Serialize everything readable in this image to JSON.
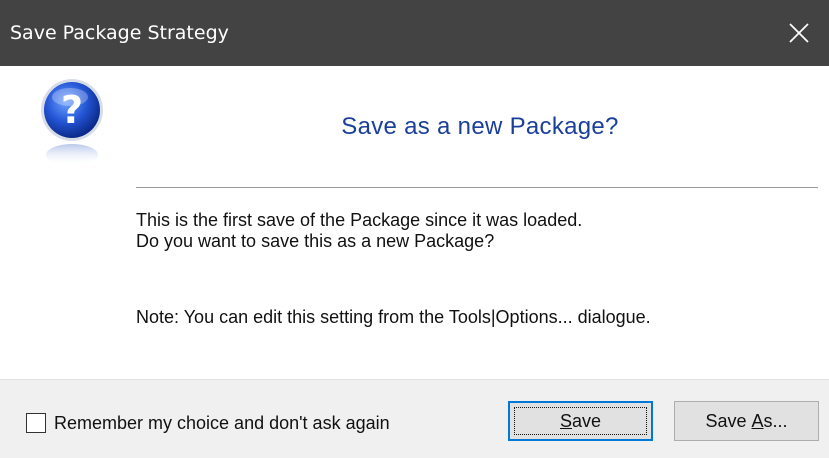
{
  "window": {
    "title": "Save Package Strategy",
    "close_icon": "close-icon"
  },
  "icon": "question-mark-icon",
  "heading": "Save as a new Package?",
  "message": {
    "line1": "This is the first save of the Package since it was loaded.",
    "line2": "Do you want to save this as a new Package?",
    "note": "Note: You can edit this setting from the Tools|Options... dialogue."
  },
  "footer": {
    "remember_label": "Remember my choice and don't ask again",
    "remember_checked": false,
    "save_button": {
      "mnemonic": "S",
      "rest": "ave"
    },
    "save_as_button": {
      "prefix": "Save ",
      "mnemonic": "A",
      "rest": "s..."
    }
  },
  "colors": {
    "titlebar": "#434343",
    "heading": "#1a3f9a",
    "focus_border": "#0078d7",
    "footer": "#f0f0f0"
  }
}
